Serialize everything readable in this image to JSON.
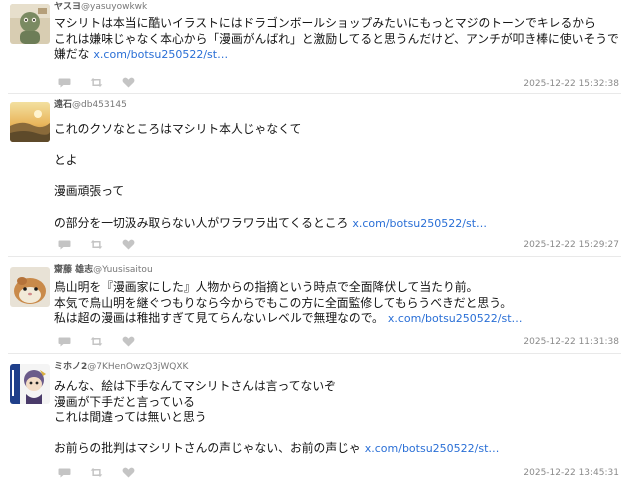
{
  "posts": [
    {
      "author": "ヤスヨ",
      "handle": "@yasuyowkwk",
      "lines": [
        "マシリトは本当に酷いイラストにはドラゴンボールショップみたいにもっとマジのトーンでキレるから",
        "これは嫌味じゃなく本心から「漫画がんばれ」と激励してると思うんだけど、アンチが叩き棒に使いそうで",
        "嫌だな"
      ],
      "link": "x.com/botsu250522/st…",
      "timestamp": "2025-12-22 15:32:38"
    },
    {
      "author": "遠石",
      "handle": "@db453145",
      "lines": [
        "これのクソなところはマシリト本人じゃなくて",
        "",
        "とよ",
        "",
        "漫画頑張って",
        "",
        "の部分を一切汲み取らない人がワラワラ出てくるところ"
      ],
      "link": "x.com/botsu250522/st…",
      "timestamp": "2025-12-22 15:29:27"
    },
    {
      "author": "齋藤 雄志",
      "handle": "@Yuusisaitou",
      "lines": [
        "鳥山明を『漫画家にした』人物からの指摘という時点で全面降伏して当たり前。",
        "本気で鳥山明を継ぐつもりなら今からでもこの方に全面監修してもらうべきだと思う。",
        "私は超の漫画は稚拙すぎて見てらんないレベルで無理なので。"
      ],
      "link": "x.com/botsu250522/st…",
      "timestamp": "2025-12-22 11:31:38"
    },
    {
      "author": "ミホノ2",
      "handle": "@7KHenOwzQ3jWQXK",
      "lines": [
        "みんな、絵は下手なんてマシリトさんは言ってないぞ",
        "漫画が下手だと言っている",
        "これは間違っては無いと思う",
        "",
        "お前らの批判はマシリトさんの声じゃない、お前の声じゃ"
      ],
      "link": "x.com/botsu250522/st…",
      "timestamp": "2025-12-22 13:45:31"
    }
  ],
  "icons": [
    "reply-icon",
    "retweet-icon",
    "like-icon"
  ],
  "colors": {
    "link": "#2a6fd6",
    "icon": "#c4c4c4",
    "timestamp": "#8a8a8a",
    "divider": "#e9e9e9"
  }
}
